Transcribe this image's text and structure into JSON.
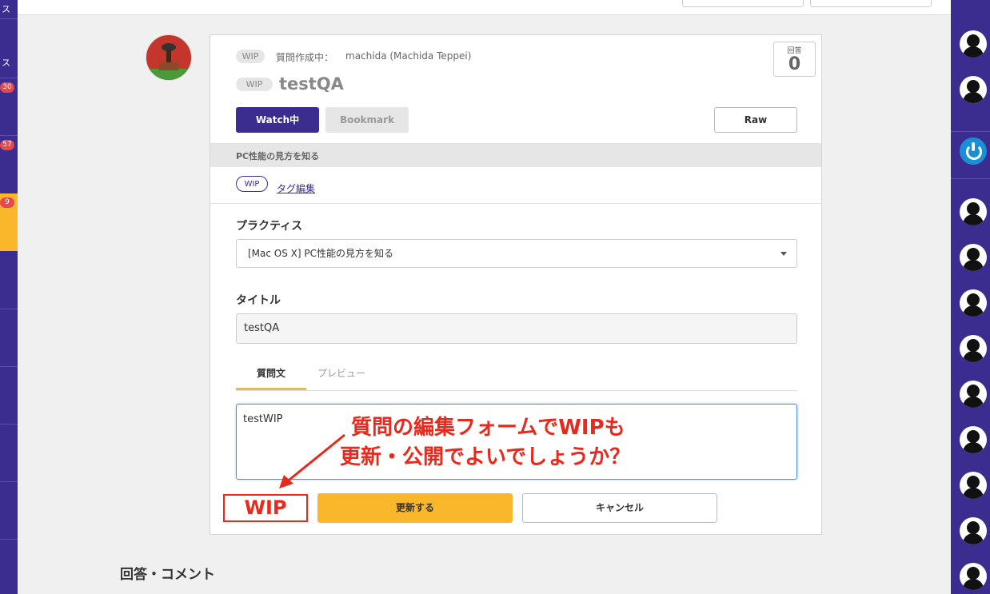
{
  "left_nav": {
    "label_top": "ス",
    "label_mid": "ス",
    "badges": [
      "30",
      "57",
      "9"
    ]
  },
  "question": {
    "wip_badge": "WIP",
    "meta_label": "質問作成中：",
    "author": "machida (Machida Teppei)",
    "title_badge": "WIP",
    "title": "testQA",
    "answers_label": "回答",
    "answers_count": "0",
    "watch_label": "Watch中",
    "bookmark_label": "Bookmark",
    "raw_label": "Raw",
    "practice_name": "PC性能の見方を知る",
    "tag": "WIP",
    "tag_edit_label": "タグ編集"
  },
  "form": {
    "practice_label": "プラクティス",
    "practice_value": "[Mac OS X] PC性能の見方を知る",
    "title_label": "タイトル",
    "title_value": "testQA",
    "tabs": [
      "質問文",
      "プレビュー"
    ],
    "body_value": "testWIP",
    "update_label": "更新する",
    "cancel_label": "キャンセル"
  },
  "annotation": {
    "wip_label": "WIP",
    "line1": "質問の編集フォームでWIPも",
    "line2": "更新・公開でよいでしょうか？",
    "color": "#e8291c"
  },
  "comments": {
    "section_title": "回答・コメント"
  },
  "colors": {
    "brand": "#3a2d8f",
    "accent": "#fbb72c",
    "badge": "#e5484d"
  }
}
